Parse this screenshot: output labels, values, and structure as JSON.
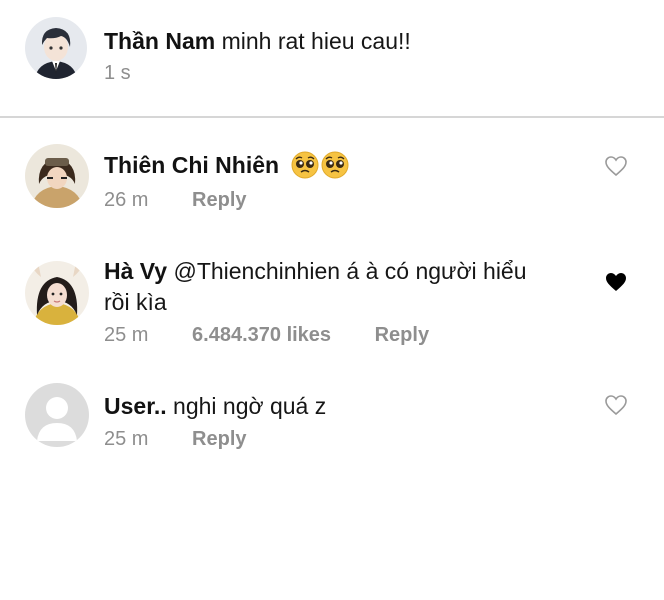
{
  "caption": {
    "username": "Thần Nam",
    "text": "minh rat hieu cau!!",
    "time": "1 s"
  },
  "comments": [
    {
      "username": "Thiên Chi Nhiên",
      "text": "",
      "emoji": [
        "pleading-face",
        "pleading-face"
      ],
      "time": "26 m",
      "likes": "",
      "reply_label": "Reply",
      "liked": false
    },
    {
      "username": "Hà Vy",
      "text_line1": "@Thienchinhien á à có người hiểu",
      "text_line2": "rồi kìa",
      "time": "25 m",
      "likes": "6.484.370 likes",
      "reply_label": "Reply",
      "liked": true
    },
    {
      "username": "User..",
      "text": "nghi ngờ quá z",
      "time": "25 m",
      "likes": "",
      "reply_label": "Reply",
      "liked": false
    }
  ],
  "colors": {
    "username": "#121212",
    "meta": "#8e8e8e",
    "divider": "#d6d6d6",
    "heart_outline": "#9a9a9a",
    "heart_filled": "#000000",
    "emoji_face": "#f6c342"
  }
}
